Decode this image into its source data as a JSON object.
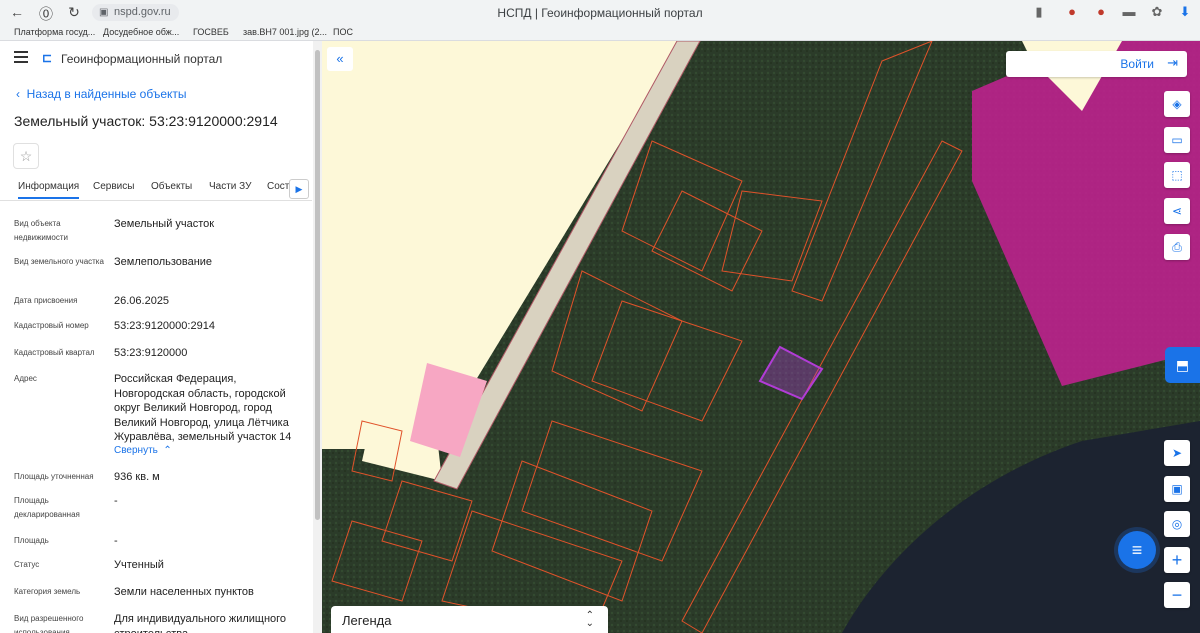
{
  "browser": {
    "url": "nspd.gov.ru",
    "tab_title": "НСПД | Геоинформационный портал",
    "bookmarks": [
      "Платформа госуд...",
      "Досудебное обж...",
      "ГОСВЕБ",
      "зав.ВН7 001.jpg (2...",
      "ПОС"
    ]
  },
  "panel": {
    "portal_title": "Геоинформационный портал",
    "back_link": "Назад в найденные объекты",
    "object_title": "Земельный участок: 53:23:9120000:2914",
    "tabs": [
      "Информация",
      "Сервисы",
      "Объекты",
      "Части ЗУ",
      "Соста..."
    ],
    "collapse_link": "Свернуть",
    "fields": [
      {
        "label": "Вид объекта недвижимости",
        "value": "Земельный участок"
      },
      {
        "label": "Вид земельного участка",
        "value": "Землепользование"
      },
      {
        "label": "Дата присвоения",
        "value": "26.06.2025"
      },
      {
        "label": "Кадастровый номер",
        "value": "53:23:9120000:2914"
      },
      {
        "label": "Кадастровый квартал",
        "value": "53:23:9120000"
      },
      {
        "label": "Адрес",
        "value": "Российская Федерация, Новгородская область, городской округ Великий Новгород, город Великий Новгород, улица Лётчика Журавлёва, земельный участок 14"
      },
      {
        "label": "Площадь уточненная",
        "value": "936 кв. м"
      },
      {
        "label": "Площадь декларированная",
        "value": "-"
      },
      {
        "label": "Площадь",
        "value": "-"
      },
      {
        "label": "Статус",
        "value": "Учтенный"
      },
      {
        "label": "Категория земель",
        "value": "Земли населенных пунктов"
      },
      {
        "label": "Вид разрешенного использования",
        "value": "Для индивидуального жилищного строительства"
      }
    ]
  },
  "map": {
    "login_label": "Войти",
    "legend_label": "Легенда",
    "tools": [
      "layers-icon",
      "ruler-icon",
      "select-area-icon",
      "share-icon",
      "print-icon",
      "locate-icon",
      "basemap-icon",
      "search-location-icon",
      "zoom-in-icon",
      "zoom-out-icon"
    ],
    "zoom_in": "+",
    "zoom_out": "−"
  },
  "colors": {
    "accent": "#1a73e8",
    "selected_parcel": "#b13cd6",
    "zone_magenta": "#c0218f",
    "zone_yellow": "#fdf8d8",
    "parcel_outline": "#e0522a"
  }
}
